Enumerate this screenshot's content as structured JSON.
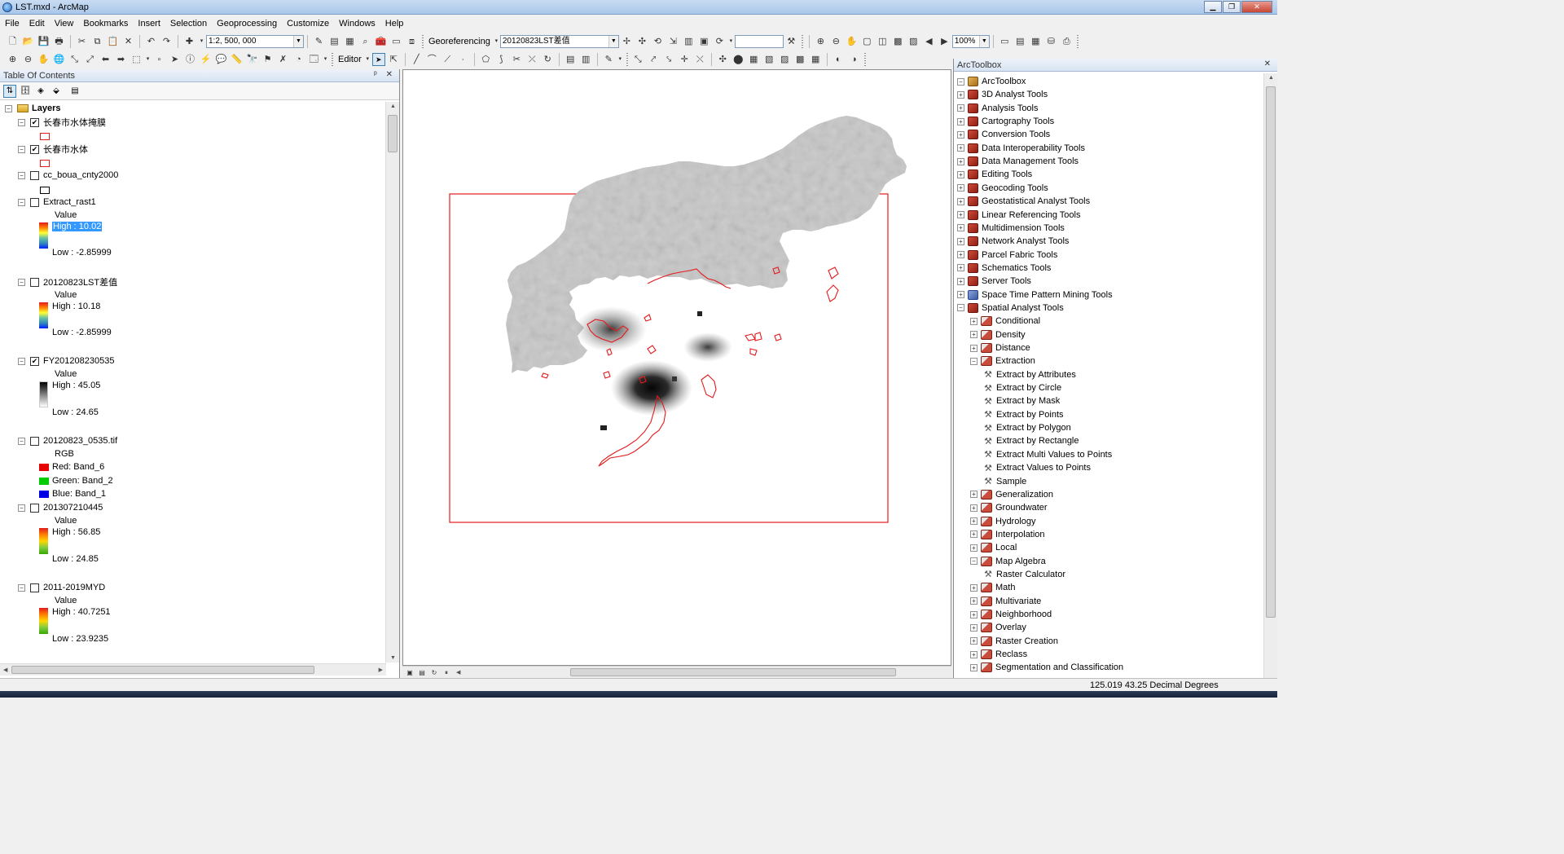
{
  "window": {
    "title": "LST.mxd - ArcMap",
    "minimize": "▁",
    "maximize": "❐",
    "close": "✕"
  },
  "menu": [
    "File",
    "Edit",
    "View",
    "Bookmarks",
    "Insert",
    "Selection",
    "Geoprocessing",
    "Customize",
    "Windows",
    "Help"
  ],
  "toolbar": {
    "scale": "1:2, 500, 000",
    "georeferencing_label": "Georeferencing",
    "layer_combo": "20120823LST差值",
    "zoom": "100%",
    "editor_label": "Editor"
  },
  "toc": {
    "title": "Table Of Contents",
    "pin": "ᵖ",
    "close": "✕",
    "root": "Layers",
    "layers": [
      {
        "name": "长春市水体掩膜",
        "checked": true,
        "symbol": "red-box"
      },
      {
        "name": "长春市水体",
        "checked": true,
        "symbol": "red-box"
      },
      {
        "name": "cc_boua_cnty2000",
        "checked": false,
        "symbol": "black-box"
      },
      {
        "name": "Extract_rast1",
        "checked": false,
        "value_label": "Value",
        "high": "High : 10.02",
        "low": "Low : -2.85999",
        "ramp": "spectral"
      },
      {
        "name": "20120823LST差值",
        "checked": false,
        "value_label": "Value",
        "high": "High : 10.18",
        "low": "Low : -2.85999",
        "ramp": "spectral"
      },
      {
        "name": "FY201208230535",
        "checked": true,
        "value_label": "Value",
        "high": "High : 45.05",
        "low": "Low : 24.65",
        "ramp": "gray"
      },
      {
        "name": "20120823_0535.tif",
        "checked": false,
        "rgb_label": "RGB",
        "red": "Red:    Band_6",
        "green": "Green: Band_2",
        "blue": "Blue:   Band_1"
      },
      {
        "name": "201307210445",
        "checked": false,
        "value_label": "Value",
        "high": "High : 56.85",
        "low": "Low : 24.85",
        "ramp": "heat"
      },
      {
        "name": "2011-2019MYD",
        "checked": false,
        "value_label": "Value",
        "high": "High : 40.7251",
        "low": "Low : 23.9235",
        "ramp": "heat"
      }
    ]
  },
  "toolbox": {
    "title": "ArcToolbox",
    "close": "✕",
    "root": "ArcToolbox",
    "items": [
      {
        "label": "3D Analyst Tools",
        "level": 1,
        "kind": "toolbox",
        "state": "+"
      },
      {
        "label": "Analysis Tools",
        "level": 1,
        "kind": "toolbox",
        "state": "+"
      },
      {
        "label": "Cartography Tools",
        "level": 1,
        "kind": "toolbox",
        "state": "+"
      },
      {
        "label": "Conversion Tools",
        "level": 1,
        "kind": "toolbox",
        "state": "+"
      },
      {
        "label": "Data Interoperability Tools",
        "level": 1,
        "kind": "toolbox",
        "state": "+"
      },
      {
        "label": "Data Management Tools",
        "level": 1,
        "kind": "toolbox",
        "state": "+"
      },
      {
        "label": "Editing Tools",
        "level": 1,
        "kind": "toolbox",
        "state": "+"
      },
      {
        "label": "Geocoding Tools",
        "level": 1,
        "kind": "toolbox",
        "state": "+"
      },
      {
        "label": "Geostatistical Analyst Tools",
        "level": 1,
        "kind": "toolbox",
        "state": "+"
      },
      {
        "label": "Linear Referencing Tools",
        "level": 1,
        "kind": "toolbox",
        "state": "+"
      },
      {
        "label": "Multidimension Tools",
        "level": 1,
        "kind": "toolbox",
        "state": "+"
      },
      {
        "label": "Network Analyst Tools",
        "level": 1,
        "kind": "toolbox",
        "state": "+"
      },
      {
        "label": "Parcel Fabric Tools",
        "level": 1,
        "kind": "toolbox",
        "state": "+"
      },
      {
        "label": "Schematics Tools",
        "level": 1,
        "kind": "toolbox",
        "state": "+"
      },
      {
        "label": "Server Tools",
        "level": 1,
        "kind": "toolbox",
        "state": "+"
      },
      {
        "label": "Space Time Pattern Mining Tools",
        "level": 1,
        "kind": "toolbox-blue",
        "state": "+"
      },
      {
        "label": "Spatial Analyst Tools",
        "level": 1,
        "kind": "toolbox",
        "state": "-"
      },
      {
        "label": "Conditional",
        "level": 2,
        "kind": "toolset",
        "state": "+"
      },
      {
        "label": "Density",
        "level": 2,
        "kind": "toolset",
        "state": "+"
      },
      {
        "label": "Distance",
        "level": 2,
        "kind": "toolset",
        "state": "+"
      },
      {
        "label": "Extraction",
        "level": 2,
        "kind": "toolset",
        "state": "-"
      },
      {
        "label": "Extract by Attributes",
        "level": 3,
        "kind": "tool",
        "state": ""
      },
      {
        "label": "Extract by Circle",
        "level": 3,
        "kind": "tool",
        "state": ""
      },
      {
        "label": "Extract by Mask",
        "level": 3,
        "kind": "tool",
        "state": ""
      },
      {
        "label": "Extract by Points",
        "level": 3,
        "kind": "tool",
        "state": ""
      },
      {
        "label": "Extract by Polygon",
        "level": 3,
        "kind": "tool",
        "state": ""
      },
      {
        "label": "Extract by Rectangle",
        "level": 3,
        "kind": "tool",
        "state": ""
      },
      {
        "label": "Extract Multi Values to Points",
        "level": 3,
        "kind": "tool",
        "state": ""
      },
      {
        "label": "Extract Values to Points",
        "level": 3,
        "kind": "tool",
        "state": ""
      },
      {
        "label": "Sample",
        "level": 3,
        "kind": "tool",
        "state": ""
      },
      {
        "label": "Generalization",
        "level": 2,
        "kind": "toolset",
        "state": "+"
      },
      {
        "label": "Groundwater",
        "level": 2,
        "kind": "toolset",
        "state": "+"
      },
      {
        "label": "Hydrology",
        "level": 2,
        "kind": "toolset",
        "state": "+"
      },
      {
        "label": "Interpolation",
        "level": 2,
        "kind": "toolset",
        "state": "+"
      },
      {
        "label": "Local",
        "level": 2,
        "kind": "toolset",
        "state": "+"
      },
      {
        "label": "Map Algebra",
        "level": 2,
        "kind": "toolset",
        "state": "-"
      },
      {
        "label": "Raster Calculator",
        "level": 3,
        "kind": "tool",
        "state": ""
      },
      {
        "label": "Math",
        "level": 2,
        "kind": "toolset",
        "state": "+"
      },
      {
        "label": "Multivariate",
        "level": 2,
        "kind": "toolset",
        "state": "+"
      },
      {
        "label": "Neighborhood",
        "level": 2,
        "kind": "toolset",
        "state": "+"
      },
      {
        "label": "Overlay",
        "level": 2,
        "kind": "toolset",
        "state": "+"
      },
      {
        "label": "Raster Creation",
        "level": 2,
        "kind": "toolset",
        "state": "+"
      },
      {
        "label": "Reclass",
        "level": 2,
        "kind": "toolset",
        "state": "+"
      },
      {
        "label": "Segmentation and Classification",
        "level": 2,
        "kind": "toolset",
        "state": "+"
      }
    ]
  },
  "status": {
    "coords": "125.019  43.25 Decimal Degrees"
  },
  "colors": {
    "accent": "#3399ff",
    "feature_outline": "#e41a1c",
    "title_bar": "#b9d1ee"
  }
}
